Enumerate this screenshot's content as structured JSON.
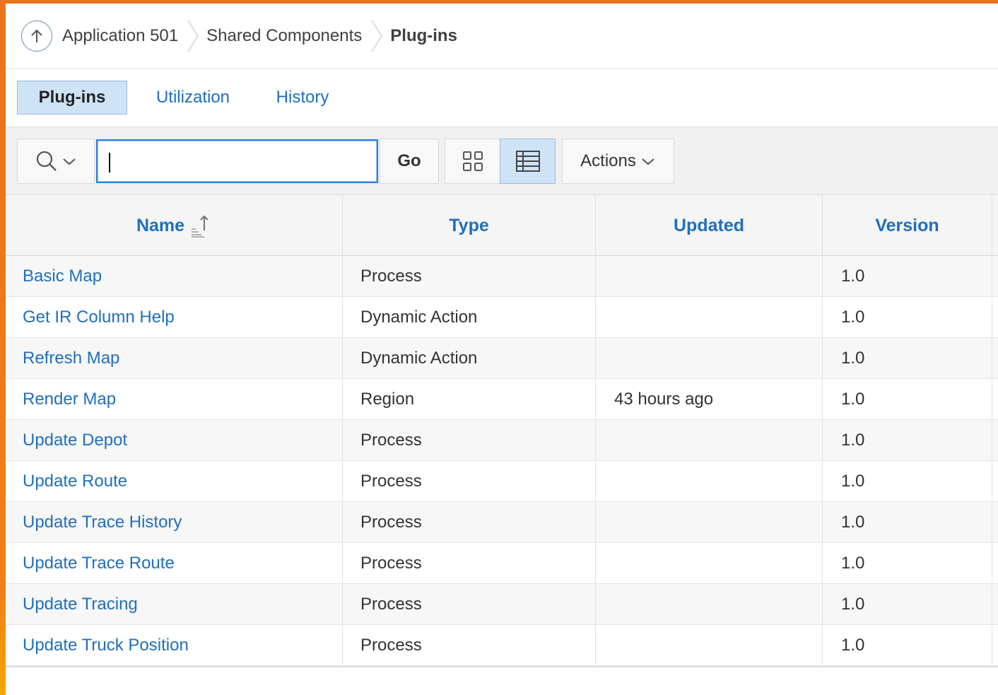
{
  "breadcrumb": {
    "items": [
      "Application 501",
      "Shared Components"
    ],
    "current": "Plug-ins"
  },
  "tabs": [
    {
      "label": "Plug-ins",
      "active": true
    },
    {
      "label": "Utilization",
      "active": false
    },
    {
      "label": "History",
      "active": false
    }
  ],
  "toolbar": {
    "search_icon": "search-icon",
    "search_value": "",
    "go_label": "Go",
    "icon_view": "grid-icon",
    "report_view": "table-icon",
    "actions_label": "Actions"
  },
  "table": {
    "columns": [
      "Name",
      "Type",
      "Updated",
      "Version"
    ],
    "sort_icon": "sort-ascending-icon",
    "rows": [
      {
        "name": "Basic Map",
        "type": "Process",
        "updated": "",
        "version": "1.0"
      },
      {
        "name": "Get IR Column Help",
        "type": "Dynamic Action",
        "updated": "",
        "version": "1.0"
      },
      {
        "name": "Refresh Map",
        "type": "Dynamic Action",
        "updated": "",
        "version": "1.0"
      },
      {
        "name": "Render Map",
        "type": "Region",
        "updated": "43 hours ago",
        "version": "1.0"
      },
      {
        "name": "Update Depot",
        "type": "Process",
        "updated": "",
        "version": "1.0"
      },
      {
        "name": "Update Route",
        "type": "Process",
        "updated": "",
        "version": "1.0"
      },
      {
        "name": "Update Trace History",
        "type": "Process",
        "updated": "",
        "version": "1.0"
      },
      {
        "name": "Update Trace Route",
        "type": "Process",
        "updated": "",
        "version": "1.0"
      },
      {
        "name": "Update Tracing",
        "type": "Process",
        "updated": "",
        "version": "1.0"
      },
      {
        "name": "Update Truck Position",
        "type": "Process",
        "updated": "",
        "version": "1.0"
      }
    ]
  },
  "colors": {
    "accent_orange": "#e8741c",
    "link_blue": "#1f6fbd",
    "active_tab_bg": "#cfe3f7"
  }
}
